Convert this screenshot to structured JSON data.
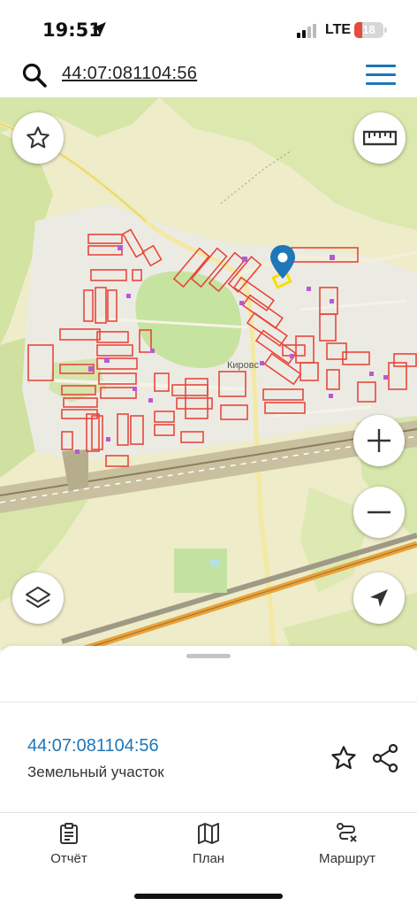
{
  "status_bar": {
    "time": "19:51",
    "network": "LTE",
    "battery": "18",
    "battery_color": "#e84a3c"
  },
  "search": {
    "query": "44:07:081104:56",
    "icon": "search-icon",
    "menu_icon": "hamburger-icon"
  },
  "map": {
    "place_label": "Кировс",
    "buttons": [
      "star-icon",
      "ruler-icon",
      "layers-icon",
      "zoom-in-icon",
      "zoom-out-icon",
      "navigation-arrow-icon"
    ],
    "marker_color": "#1f76b8",
    "parcel_color": "#e8473c",
    "selected_parcel_color": "#f5e000"
  },
  "sheet": {
    "parcel_id": "44:07:081104:56",
    "parcel_type": "Земельный участок",
    "accent": "#1f76b8"
  },
  "nav": [
    {
      "label": "Отчёт",
      "icon": "clipboard-icon"
    },
    {
      "label": "План",
      "icon": "map-icon"
    },
    {
      "label": "Маршрут",
      "icon": "route-icon"
    }
  ]
}
